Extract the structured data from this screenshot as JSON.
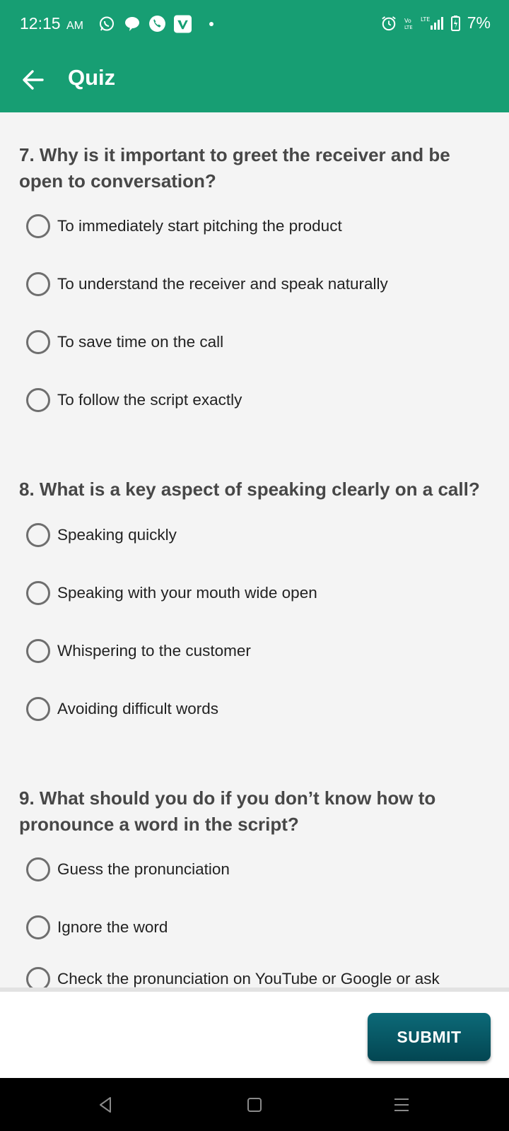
{
  "status_bar": {
    "time": "12:15",
    "ampm": "AM",
    "battery": "7%",
    "icons": [
      "whatsapp-icon",
      "chat-icon",
      "viber-icon",
      "vimeo-icon",
      "alarm-icon",
      "volte-icon",
      "lte-signal-icon",
      "battery-charging-icon"
    ]
  },
  "app_bar": {
    "title": "Quiz",
    "back_icon": "arrow-left-icon"
  },
  "questions": [
    {
      "text": "7. Why is it important to greet the receiver and be open to conversation?",
      "options": [
        "To immediately start pitching the product",
        "To understand the receiver and speak naturally",
        "To save time on the call",
        "To follow the script exactly"
      ]
    },
    {
      "text": "8. What is a key aspect of speaking clearly on a call?",
      "options": [
        "Speaking quickly",
        "Speaking with your mouth wide open",
        "Whispering to the customer",
        "Avoiding difficult words"
      ]
    },
    {
      "text": "9. What should you do if you don’t know how to pronounce a word in the script?",
      "options": [
        "Guess the pronunciation",
        "Ignore the word",
        "Check the pronunciation on YouTube or Google or ask"
      ]
    }
  ],
  "submit_label": "SUBMIT",
  "nav_bar": {
    "icons": [
      "back-triangle-icon",
      "home-square-icon",
      "menu-lines-icon"
    ]
  },
  "colors": {
    "primary": "#179e73",
    "submit": "#085a66",
    "question_text": "#474747",
    "option_text": "#222222"
  }
}
